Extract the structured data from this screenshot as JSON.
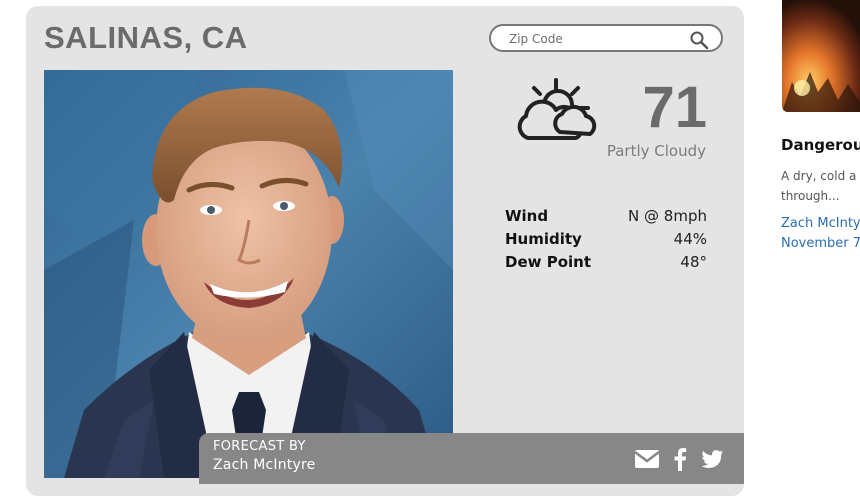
{
  "location": {
    "city": "SALINAS, CA"
  },
  "search": {
    "placeholder": "Zip Code"
  },
  "current": {
    "temperature": "71",
    "condition": "Partly Cloudy",
    "condition_icon": "partly-cloudy-icon"
  },
  "stats": [
    {
      "label": "Wind",
      "value": "N @ 8mph"
    },
    {
      "label": "Humidity",
      "value": "44%"
    },
    {
      "label": "Dew Point",
      "value": "48°"
    }
  ],
  "forecaster": {
    "label": "FORECAST BY",
    "name": "Zach McIntyre"
  },
  "share_icons": [
    "email-icon",
    "facebook-icon",
    "twitter-icon"
  ],
  "news": {
    "title": "Dangerou",
    "snippet_line1": "A dry, cold a",
    "snippet_line2": "through...",
    "author": "Zach McInty",
    "date": "November 7"
  },
  "colors": {
    "card_bg": "#e4e4e4",
    "heading_gray": "#6b6b6b",
    "bar_gray": "#878787",
    "link_blue": "#2a6db5"
  }
}
